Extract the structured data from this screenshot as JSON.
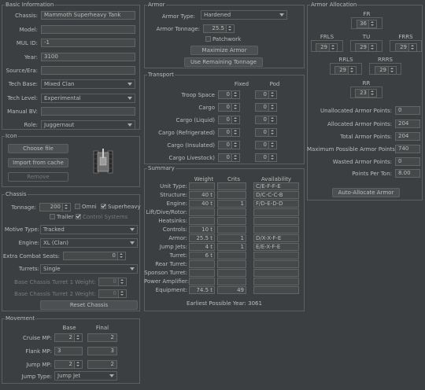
{
  "basic": {
    "title": "Basic Information",
    "chassis_label": "Chassis:",
    "chassis": "Mammoth Superheavy Tank",
    "model_label": "Model:",
    "model": "",
    "mulid_label": "MUL ID:",
    "mulid": "-1",
    "year_label": "Year:",
    "year": "3100",
    "source_label": "Source/Era:",
    "source": "",
    "techbase_label": "Tech Base:",
    "techbase": "Mixed Clan",
    "techlevel_label": "Tech Level:",
    "techlevel": "Experimental",
    "manualbv_label": "Manual BV:",
    "manualbv": "",
    "role_label": "Role:",
    "role": "Juggernaut"
  },
  "icon": {
    "title": "Icon",
    "choose": "Choose file",
    "import": "Import from cache",
    "remove": "Remove"
  },
  "chassis": {
    "title": "Chassis",
    "tonnage_label": "Tonnage:",
    "tonnage": "200",
    "omni": "Omni",
    "superheavy": "Superheavy",
    "trailer": "Trailer",
    "control": "Control Systems",
    "motive_label": "Motive Type:",
    "motive": "Tracked",
    "engine_label": "Engine:",
    "engine": "XL (Clan)",
    "seats_label": "Extra Combat Seats:",
    "seats": "0",
    "turrets_label": "Turrets:",
    "turrets": "Single",
    "t1_label": "Base Chassis Turret 1 Weight:",
    "t1": "0",
    "t2_label": "Base Chassis Turret 2 Weight:",
    "t2": "0",
    "reset": "Reset Chassis"
  },
  "movement": {
    "title": "Movement",
    "base_h": "Base",
    "final_h": "Final",
    "cruise_label": "Cruise MP:",
    "cruise_base": "2",
    "cruise_final": "2",
    "flank_label": "Flank MP:",
    "flank_base": "3",
    "flank_final": "3",
    "jump_label": "Jump MP:",
    "jump_base": "2",
    "jump_final": "2",
    "jumptype_label": "Jump Type:",
    "jumptype": "Jump Jet"
  },
  "armor": {
    "title": "Armor",
    "type_label": "Armor Type:",
    "type": "Hardened",
    "tonnage_label": "Armor Tonnage:",
    "tonnage": "25.5",
    "patchwork": "Patchwork",
    "maximize": "Maximize Armor",
    "remaining": "Use Remaining Tonnage"
  },
  "transport": {
    "title": "Transport",
    "fixed_h": "Fixed",
    "pod_h": "Pod",
    "rows": [
      {
        "label": "Troop Space",
        "fixed": "0",
        "pod": "0"
      },
      {
        "label": "Cargo",
        "fixed": "0",
        "pod": "0"
      },
      {
        "label": "Cargo (Liquid)",
        "fixed": "0",
        "pod": "0"
      },
      {
        "label": "Cargo (Refrigerated)",
        "fixed": "0",
        "pod": "0"
      },
      {
        "label": "Cargo (Insulated)",
        "fixed": "0",
        "pod": "0"
      },
      {
        "label": "Cargo Livestock)",
        "fixed": "0",
        "pod": "0"
      }
    ]
  },
  "summary": {
    "title": "Summary",
    "weight_h": "Weight",
    "crits_h": "Crits",
    "avail_h": "Availability",
    "rows": [
      {
        "label": "Unit Type:",
        "weight": "",
        "crits": "",
        "avail": "C/E-F-F-E"
      },
      {
        "label": "Structure:",
        "weight": "40 t",
        "crits": "",
        "avail": "D/C-C-C-B"
      },
      {
        "label": "Engine:",
        "weight": "40 t",
        "crits": "1",
        "avail": "F/D-E-D-D"
      },
      {
        "label": "Lift/Dive/Rotor:",
        "weight": "",
        "crits": "",
        "avail": ""
      },
      {
        "label": "Heatsinks:",
        "weight": "",
        "crits": "",
        "avail": ""
      },
      {
        "label": "Controls:",
        "weight": "10 t",
        "crits": "",
        "avail": ""
      },
      {
        "label": "Armor:",
        "weight": "25.5 t",
        "crits": "1",
        "avail": "D/X-X-F-E"
      },
      {
        "label": "Jump Jets:",
        "weight": "4 t",
        "crits": "1",
        "avail": "E/E-X-F-E"
      },
      {
        "label": "Turret:",
        "weight": "6 t",
        "crits": "",
        "avail": ""
      },
      {
        "label": "Rear Turret:",
        "weight": "",
        "crits": "",
        "avail": ""
      },
      {
        "label": "Sponson Turret:",
        "weight": "",
        "crits": "",
        "avail": ""
      },
      {
        "label": "Power Amplifier:",
        "weight": "",
        "crits": "",
        "avail": ""
      },
      {
        "label": "Equipment:",
        "weight": "74.5 t",
        "crits": "49",
        "avail": ""
      }
    ],
    "earliest": "Earliest Possible Year: 3061"
  },
  "alloc": {
    "title": "Armor Allocation",
    "fr_label": "FR",
    "fr": "36",
    "frls_label": "FRLS",
    "frls": "29",
    "tu_label": "TU",
    "tu": "29",
    "frrs_label": "FRRS",
    "frrs": "29",
    "rrls_label": "RRLS",
    "rrls": "29",
    "rrrs_label": "RRRS",
    "rrrs": "29",
    "rr_label": "RR",
    "rr": "23",
    "unalloc_label": "Unallocated Armor Points:",
    "unalloc": "0",
    "allocated_label": "Allocated Armor Points:",
    "allocated": "204",
    "total_label": "Total Armor Points:",
    "total": "204",
    "max_label": "Maximum Possible Armor Points:",
    "max": "740",
    "wasted_label": "Wasted Armor Points:",
    "wasted": "0",
    "ppt_label": "Points Per Ton:",
    "ppt": "8.00",
    "auto": "Auto-Allocate Armor"
  }
}
